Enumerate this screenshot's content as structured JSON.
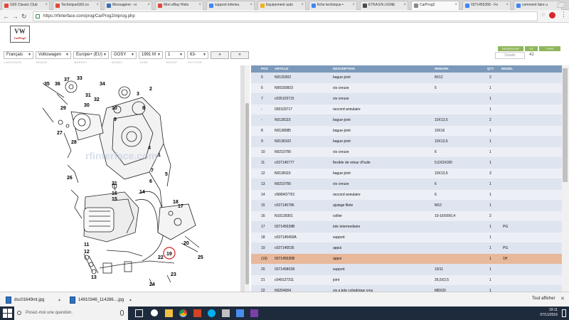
{
  "browser": {
    "tabs": [
      {
        "label": "G60 Classic Club",
        "color": "#e0483c"
      },
      {
        "label": "TechniqueG60.co",
        "color": "#e0483c"
      },
      {
        "label": "Messagerie - vi",
        "color": "#3b6db2"
      },
      {
        "label": "Mon eBay Histo",
        "color": "#e0483c"
      },
      {
        "label": "support inferieu",
        "color": "#4285f4"
      },
      {
        "label": "Equipement auto",
        "color": "#f2b31c"
      },
      {
        "label": "fiche technique •",
        "color": "#4285f4"
      },
      {
        "label": "ETKA EN LIGNE",
        "color": "#4a4a4a"
      },
      {
        "label": "CarProg2",
        "color": "#888888"
      },
      {
        "label": "0371455358 - Fo",
        "color": "#4285f4"
      },
      {
        "label": "comment faire u",
        "color": "#4285f4"
      }
    ],
    "url": "https://rfinterface.com/prog/CarProg2/inprog.php"
  },
  "app": {
    "logo_text": "VW",
    "logo_sub": "CarProg2"
  },
  "filters": {
    "language": "Français",
    "brand": "Volkswagen",
    "market": "Europe+ (EU)",
    "model": "GOSY",
    "year": "1991  M",
    "group": "1",
    "picture": "63-",
    "prev_label": "«",
    "next_label": "»",
    "details_label": "Details",
    "page_number": "42",
    "labels": [
      "LANGUAGE",
      "BRAND",
      "MARKET",
      "MODEL",
      "YEAR",
      "GROUP",
      "PICTURE"
    ],
    "right_buttons": [
      "RESERVOIR",
      "VS",
      "TYPE"
    ]
  },
  "diagram": {
    "callouts": [
      "36",
      "35",
      "37",
      "34",
      "33",
      "31",
      "32",
      "29",
      "30",
      "27",
      "28",
      "26",
      "10",
      "9",
      "8",
      "3",
      "2",
      "4",
      "1",
      "7",
      "5",
      "6",
      "21",
      "16",
      "15",
      "14",
      "17",
      "18",
      "19",
      "20",
      "11",
      "12",
      "13",
      "22",
      "23",
      "24",
      "25"
    ],
    "highlight_callout": "19",
    "watermark": "rfinterface.com"
  },
  "table": {
    "headers": [
      "POS",
      "ARTICLE",
      "DESCRIPTION",
      "REMARK",
      "QTY",
      "MODEL"
    ],
    "rows": [
      {
        "pos": "5",
        "article": "N0130302",
        "desc": "bague-joint",
        "remark": "8X12",
        "qty": "2",
        "model": ""
      },
      {
        "pos": "6",
        "article": "N00183603",
        "desc": "vis creuse",
        "remark": "5",
        "qty": "1",
        "model": ""
      },
      {
        "pos": "7",
        "article": "c035103715",
        "desc": "vis creuse",
        "remark": "",
        "qty": "1",
        "model": ""
      },
      {
        "pos": "-",
        "article": "030103717",
        "desc": "raccord annulaire",
        "remark": "",
        "qty": "1",
        "model": ""
      },
      {
        "pos": "-",
        "article": "N0138115",
        "desc": "bague-joint",
        "remark": "10X13,5",
        "qty": "2",
        "model": ""
      },
      {
        "pos": "8",
        "article": "N0138085",
        "desc": "bague-joint",
        "remark": "10X16",
        "qty": "1",
        "model": ""
      },
      {
        "pos": "9",
        "article": "N0138102",
        "desc": "bague-joint",
        "remark": "10X13,5",
        "qty": "1",
        "model": ""
      },
      {
        "pos": "10",
        "article": "N0210756",
        "desc": "vis creuse",
        "remark": "6",
        "qty": "1",
        "model": ""
      },
      {
        "pos": "11",
        "article": "c037145777",
        "desc": "flexible de retour d'huile",
        "remark": "5,5X3X180",
        "qty": "1",
        "model": ""
      },
      {
        "pos": "12",
        "article": "N0138115",
        "desc": "bague-joint",
        "remark": "10X13,5",
        "qty": "3",
        "model": ""
      },
      {
        "pos": "13",
        "article": "N0210756",
        "desc": "vis creuse",
        "remark": "6",
        "qty": "1",
        "model": ""
      },
      {
        "pos": "14",
        "article": "cN90437701",
        "desc": "raccord annulaire",
        "remark": "6",
        "qty": "1",
        "model": ""
      },
      {
        "pos": "15",
        "article": "c037145786",
        "desc": "ajutage filete",
        "remark": "M10",
        "qty": "1",
        "model": ""
      },
      {
        "pos": "16",
        "article": "N10139301",
        "desc": "collier",
        "remark": "10-16X9X0,4",
        "qty": "2",
        "model": ""
      },
      {
        "pos": "17",
        "article": "037145539B",
        "desc": "tole intermediaire",
        "remark": "",
        "qty": "1",
        "model": "PG"
      },
      {
        "pos": "18",
        "article": "c037145493A",
        "desc": "support",
        "remark": "",
        "qty": "1",
        "model": ""
      },
      {
        "pos": "19",
        "article": "c037145535",
        "desc": "appui",
        "remark": "",
        "qty": "1",
        "model": "PG"
      },
      {
        "pos": "(19)",
        "article": "037145535B",
        "desc": "appui",
        "remark": "",
        "qty": "1",
        "model": "1H"
      },
      {
        "pos": "20",
        "article": "037145801B",
        "desc": "support",
        "remark": "10/11",
        "qty": "1",
        "model": ""
      },
      {
        "pos": "21",
        "article": "c049127311",
        "desc": "joint",
        "remark": "26,5X2,5",
        "qty": "1",
        "model": ""
      },
      {
        "pos": "22",
        "article": "N0204004",
        "desc": "vis a tete cylindrique creu",
        "remark": "M8X20",
        "qty": "1",
        "model": ""
      }
    ],
    "highlight_index": 17,
    "row_even_color": "#dfe5f0",
    "row_highlight_color": "#e8b89a",
    "header_color": "#7b99ba"
  },
  "downloads": [
    {
      "name": "dsc01649mt.jpg"
    },
    {
      "name": "14910346_114286....jpg"
    }
  ],
  "downloads_show_all": "Tout afficher",
  "taskbar": {
    "search_placeholder": "Posez-moi une question.",
    "time": "19:11",
    "date": "07/11/2016"
  }
}
